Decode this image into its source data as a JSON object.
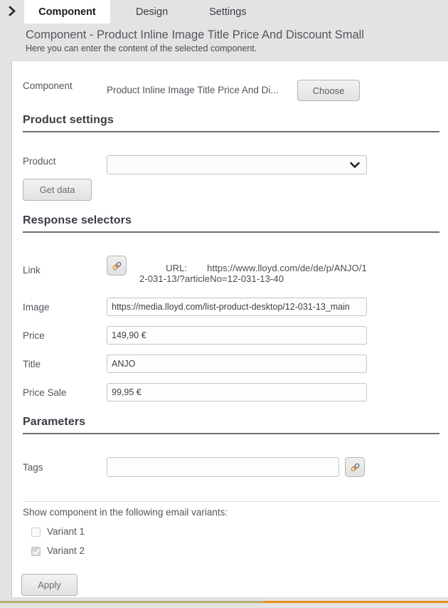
{
  "tabs": [
    {
      "label": "Component",
      "active": true
    },
    {
      "label": "Design",
      "active": false
    },
    {
      "label": "Settings",
      "active": false
    }
  ],
  "header": {
    "title": "Component - Product Inline Image Title Price And Discount Small",
    "subtitle": "Here you can enter the content of the selected component."
  },
  "component_row": {
    "label": "Component",
    "value": "Product Inline Image Title Price And Di...",
    "choose_button": "Choose"
  },
  "sections": {
    "product_settings": "Product settings",
    "response_selectors": "Response selectors",
    "parameters": "Parameters"
  },
  "product": {
    "label": "Product",
    "selected": "",
    "get_data_button": "Get data"
  },
  "selectors": {
    "link": {
      "label": "Link",
      "url_key": "URL:",
      "url_value": "https://www.lloyd.com/de/de/p/ANJO/12-031-13/?articleNo=12-031-13-40"
    },
    "image": {
      "label": "Image",
      "value": "https://media.lloyd.com/list-product-desktop/12-031-13_main"
    },
    "price": {
      "label": "Price",
      "value": "149,90 €"
    },
    "title": {
      "label": "Title",
      "value": "ANJO"
    },
    "price_sale": {
      "label": "Price Sale",
      "value": "99,95 €"
    }
  },
  "parameters": {
    "tags": {
      "label": "Tags",
      "value": "",
      "placeholder": ""
    }
  },
  "variants": {
    "heading": "Show component in the following email variants:",
    "items": [
      {
        "label": "Variant 1",
        "checked": false
      },
      {
        "label": "Variant 2",
        "checked": true
      }
    ]
  },
  "footer": {
    "apply_button": "Apply"
  },
  "colors": {
    "panel_bg": "#ffffff",
    "chrome_bg": "#e3e3e3",
    "section_rule": "#6e6e6e",
    "label_text": "#55555f",
    "accent_orange": "#e8921a",
    "accent_tan": "#b9ad74"
  }
}
